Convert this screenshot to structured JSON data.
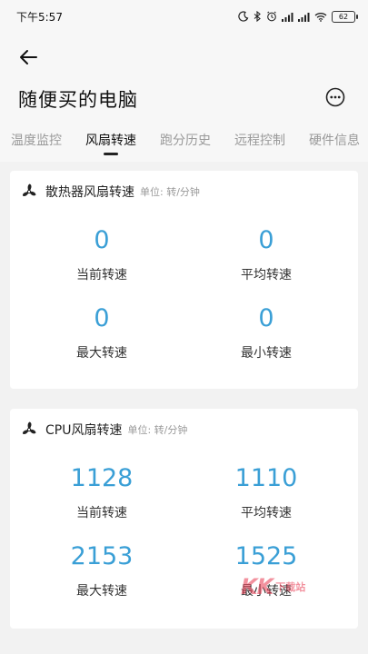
{
  "status_bar": {
    "time": "下午5:57",
    "battery": "62",
    "icons": [
      "moon-icon",
      "bluetooth-icon",
      "alarm-icon",
      "signal-icon",
      "signal-icon",
      "wifi-icon",
      "battery-icon"
    ]
  },
  "header": {
    "title": "随便买的电脑"
  },
  "tabs": [
    {
      "label": "温度监控",
      "active": false
    },
    {
      "label": "风扇转速",
      "active": true
    },
    {
      "label": "跑分历史",
      "active": false
    },
    {
      "label": "远程控制",
      "active": false
    },
    {
      "label": "硬件信息",
      "active": false
    }
  ],
  "cards": [
    {
      "title": "散热器风扇转速",
      "unit": "单位: 转/分钟",
      "stats": {
        "current": {
          "value": "0",
          "label": "当前转速"
        },
        "average": {
          "value": "0",
          "label": "平均转速"
        },
        "max": {
          "value": "0",
          "label": "最大转速"
        },
        "min": {
          "value": "0",
          "label": "最小转速"
        }
      }
    },
    {
      "title": "CPU风扇转速",
      "unit": "单位: 转/分钟",
      "stats": {
        "current": {
          "value": "1128",
          "label": "当前转速"
        },
        "average": {
          "value": "1110",
          "label": "平均转速"
        },
        "max": {
          "value": "2153",
          "label": "最大转速"
        },
        "min": {
          "value": "1525",
          "label": "最小转速"
        }
      }
    }
  ],
  "watermark": {
    "logo": "KK",
    "text": "下载站"
  },
  "colors": {
    "accent_value": "#3a9fd6",
    "background": "#f2f2f2",
    "card": "#ffffff",
    "watermark": "#e8384f"
  }
}
